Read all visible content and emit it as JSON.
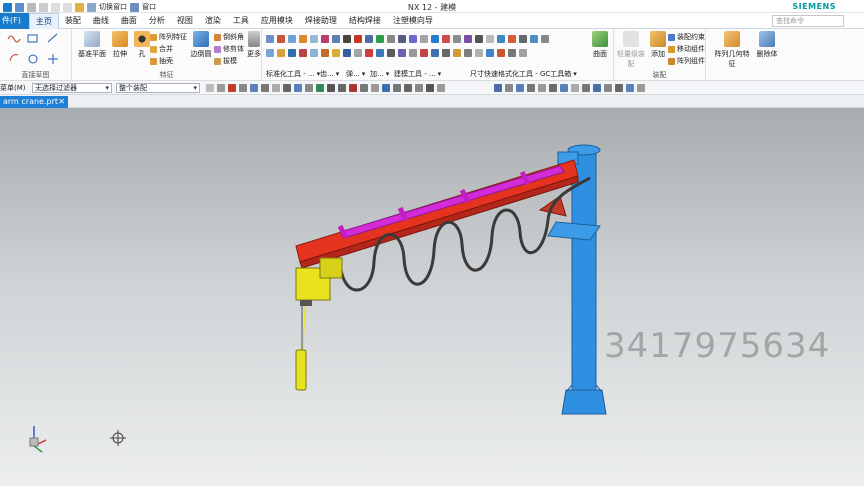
{
  "app": {
    "title": "NX 12 - 建模",
    "brand": "SIEMENS",
    "search_placeholder": "查找命令"
  },
  "qat": {
    "switch_window": "切换窗口",
    "window": "窗口"
  },
  "menu": {
    "file": "件(F)",
    "items": [
      "主页",
      "装配",
      "曲线",
      "曲面",
      "分析",
      "视图",
      "渲染",
      "工具",
      "应用模块",
      "焊接助理",
      "结构焊接",
      "注塑模向导"
    ]
  },
  "ribbon": {
    "sketch_group": "直接草图",
    "feature_group": "特征",
    "datum_plane": "基准平面",
    "extrude": "拉伸",
    "hole": "孔",
    "pattern_feature": "阵列特征",
    "unite": "合并",
    "shell": "抽壳",
    "edge_blend": "边倒圆",
    "chamfer": "倒斜角",
    "trim_body": "修剪体",
    "draft": "拔模",
    "more": "更多",
    "std_tools": "标准化工具 - ...",
    "gc_short": "齿...",
    "spring": "弹...",
    "add": "加...",
    "model_tools": "建模工具 - ...",
    "dim_tools": "尺寸快速格式化工具 - GC工具箱",
    "surface": "曲面",
    "assembly_nav": "轻量级装配",
    "add_comp": "添加",
    "assembly_constraint": "装配约束",
    "move_component": "移动组件",
    "pattern_component": "阵列组件",
    "assembly_group": "装配",
    "pattern_geometry": "阵列几何特征",
    "delete_body": "删除体"
  },
  "toolbar2": {
    "menu_label": "菜单(M)",
    "filter": "无选择过滤器",
    "scope": "整个装配"
  },
  "tabs": [
    {
      "label": "arm crane.prt"
    }
  ],
  "watermark": "3417975634",
  "colors": {
    "beam": "#e53320",
    "magenta": "#d42bd8",
    "column": "#2f8fe0",
    "hoist": "#e8e21f",
    "cable": "#3a3a3a",
    "accent": "#1979ca"
  }
}
